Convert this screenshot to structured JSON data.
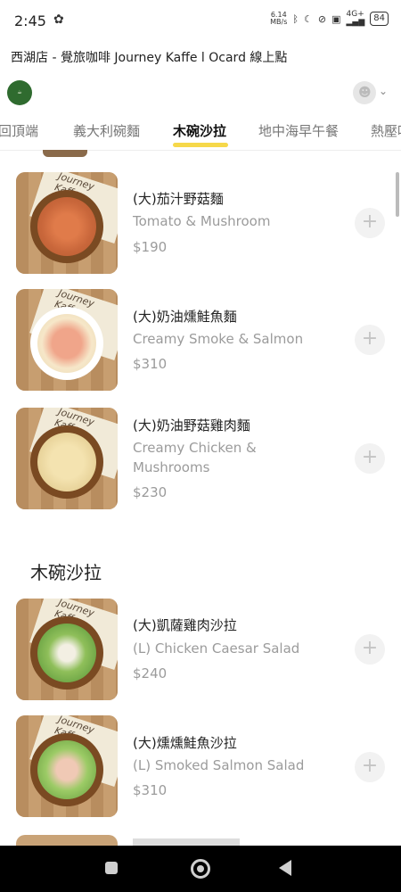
{
  "status": {
    "time": "2:45",
    "netspeed_value": "6.14",
    "netspeed_unit": "MB/s",
    "battery": "84",
    "network": "4G+"
  },
  "title": "西湖店 - 覺旅咖啡 Journey Kaffe l Ocard 線上點",
  "tabs": [
    {
      "label": "回頂端"
    },
    {
      "label": "義大利碗麵"
    },
    {
      "label": "木碗沙拉"
    },
    {
      "label": "地中海早午餐"
    },
    {
      "label": "熱壓吐司"
    }
  ],
  "image_brand_text": "Journey Kaffe",
  "section_title": "木碗沙拉",
  "items": [
    {
      "name": "(大)茄汁野菇麵",
      "en": "Tomato & Mushroom",
      "price": "$190"
    },
    {
      "name": "(大)奶油燻鮭魚麵",
      "en": "Creamy Smoke & Salmon",
      "price": "$310"
    },
    {
      "name": "(大)奶油野菇雞肉麵",
      "en": "Creamy Chicken & Mushrooms",
      "price": "$230"
    },
    {
      "name": "(大)凱薩雞肉沙拉",
      "en": "(L) Chicken Caesar Salad",
      "price": "$240"
    },
    {
      "name": "(大)燻燻鮭魚沙拉",
      "en": "(L) Smoked Salmon Salad",
      "price": "$310"
    }
  ],
  "add_symbol": "+",
  "icons": {
    "status_pin": "pinwheel-icon",
    "add": "plus-icon",
    "avatar": "user-avatar-icon",
    "chevron": "chevron-down-icon",
    "nav_recent": "square-icon",
    "nav_home": "home-circle-icon",
    "nav_back": "back-triangle-icon"
  },
  "colors": {
    "tab_underline": "#f6d84a",
    "logo_bg": "#2f6b2f",
    "muted_text": "#9b9b9b",
    "nav_bar": "#000000"
  }
}
